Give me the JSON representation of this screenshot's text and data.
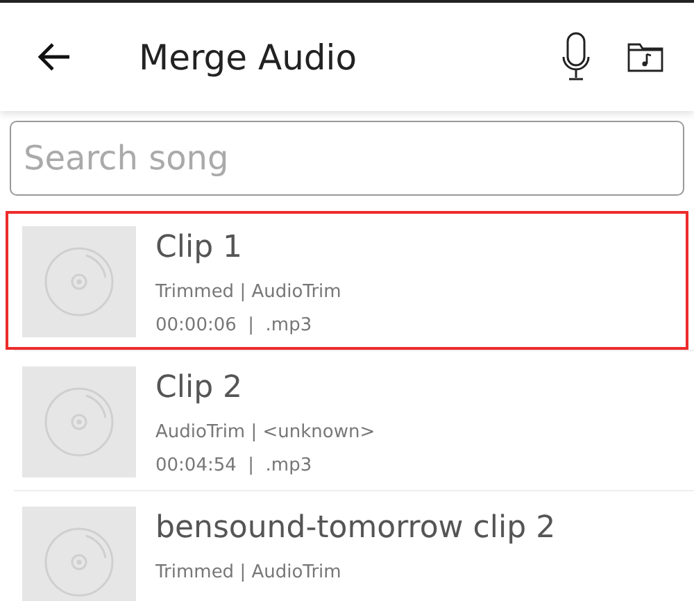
{
  "app_bar": {
    "title": "Merge Audio"
  },
  "search": {
    "placeholder": "Search song"
  },
  "songs": [
    {
      "title": "Clip 1",
      "subtitle": "Trimmed | AudioTrim",
      "details": "00:00:06  |  .mp3",
      "selected": true
    },
    {
      "title": "Clip 2",
      "subtitle": "AudioTrim | <unknown>",
      "details": "00:04:54  |  .mp3",
      "selected": false
    },
    {
      "title": "bensound-tomorrow clip 2",
      "subtitle": "Trimmed | AudioTrim",
      "selected": false
    }
  ]
}
